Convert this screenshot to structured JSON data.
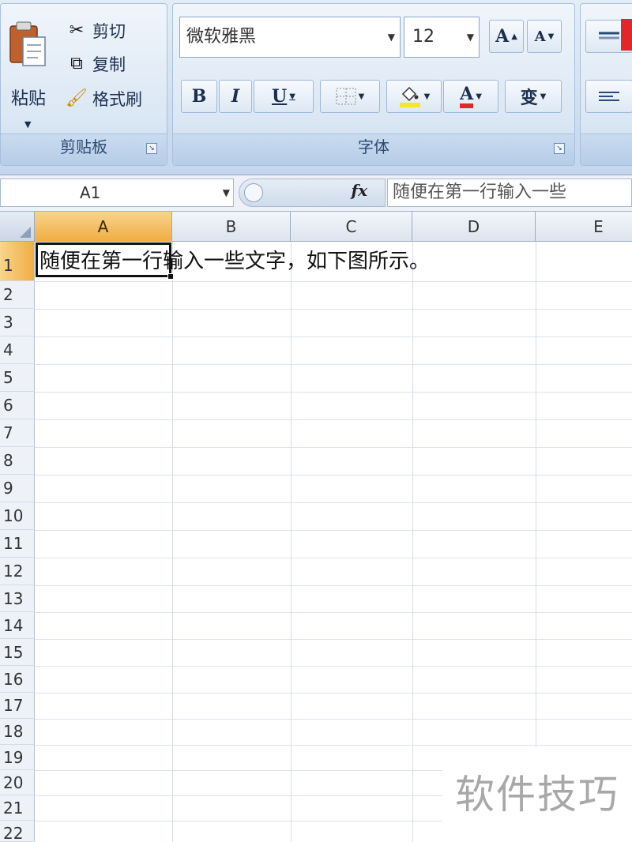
{
  "clipboard": {
    "paste_label": "粘贴",
    "cut_label": "剪切",
    "copy_label": "复制",
    "format_painter_label": "格式刷",
    "group_label": "剪贴板"
  },
  "font": {
    "font_name": "微软雅黑",
    "font_size": "12",
    "grow_label": "A",
    "shrink_label": "A",
    "bold_label": "B",
    "italic_label": "I",
    "underline_label": "U",
    "font_color_label": "A",
    "phonetic_label": "变",
    "group_label": "字体",
    "colors": {
      "fill_color": "#f5e628",
      "font_color": "#e3262a"
    }
  },
  "formula_bar": {
    "name_box": "A1",
    "fx_label": "fx",
    "content": "随便在第一行输入一些"
  },
  "grid": {
    "columns": [
      "A",
      "B",
      "C",
      "D",
      "E"
    ],
    "rows": [
      "1",
      "2",
      "3",
      "4",
      "5",
      "6",
      "7",
      "8",
      "9",
      "10",
      "11",
      "12",
      "13",
      "14",
      "15",
      "16",
      "17",
      "18",
      "19",
      "20",
      "21",
      "22"
    ],
    "active_cell": "A1",
    "cell_a1": "随便在第一行输入一些文字，如下图所示。"
  },
  "watermark": {
    "text": "软件技巧"
  },
  "theme": {
    "ribbon_bg": "#d2e1f1",
    "active_header": "#f0ad44",
    "gridline": "#d7dde6"
  }
}
